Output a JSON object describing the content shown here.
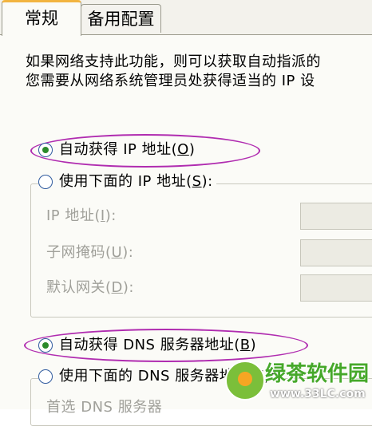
{
  "tabs": [
    {
      "label": "常规",
      "active": true
    },
    {
      "label": "备用配置",
      "active": false
    }
  ],
  "description": {
    "line1": "如果网络支持此功能，则可以获取自动指派的",
    "line2": "您需要从网络系统管理员处获得适当的 IP 设"
  },
  "ip": {
    "auto_label": "自动获得 IP 地址(",
    "auto_key": "O",
    "auto_end": ")",
    "manual_label": "使用下面的 IP 地址(",
    "manual_key": "S",
    "manual_end": "):",
    "fields": [
      {
        "label": "IP 地址(",
        "key": "I",
        "end": "):"
      },
      {
        "label": "子网掩码(",
        "key": "U",
        "end": "):"
      },
      {
        "label": "默认网关(",
        "key": "D",
        "end": "):"
      }
    ]
  },
  "dns": {
    "auto_label": "自动获得 DNS 服务器地址(",
    "auto_key": "B",
    "auto_end": ")",
    "manual_label": "使用下面的 DNS 服务器地址(",
    "manual_key": "E",
    "manual_end": "):",
    "preferred_label": "首选 DNS 服务器"
  },
  "watermark": {
    "title": "绿茶软件园",
    "url": "www.33LC.com"
  },
  "colors": {
    "tab_highlight": "#f2b440",
    "radio_dot": "#2b8a2b",
    "annotation": "#b02cb0"
  }
}
